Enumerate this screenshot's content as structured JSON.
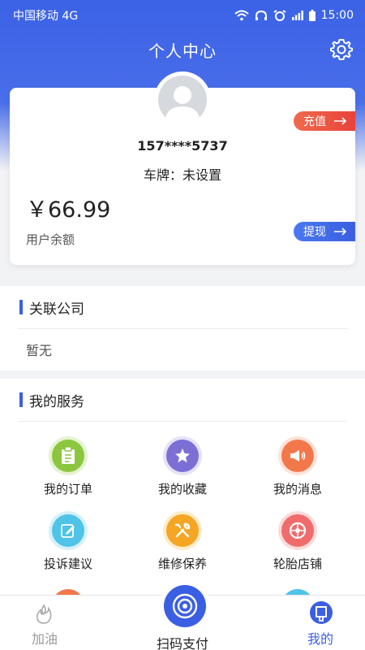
{
  "status_bar": {
    "carrier": "中国移动 4G",
    "time": "15:00"
  },
  "header": {
    "title": "个人中心",
    "settings_icon": "gear-icon"
  },
  "profile": {
    "phone": "157****5737",
    "plate": "车牌：未设置",
    "balance": "￥66.99",
    "balance_label": "用户余额",
    "recharge_label": "充值",
    "withdraw_label": "提现"
  },
  "company": {
    "title": "关联公司",
    "empty_text": "暂无"
  },
  "services": {
    "title": "我的服务",
    "items": [
      {
        "label": "我的订单",
        "icon": "clipboard-icon",
        "color": "#8cc63f"
      },
      {
        "label": "我的收藏",
        "icon": "star-icon",
        "color": "#7b6fd6"
      },
      {
        "label": "我的消息",
        "icon": "megaphone-icon",
        "color": "#f2784b"
      },
      {
        "label": "投诉建议",
        "icon": "edit-icon",
        "color": "#4fc3e8"
      },
      {
        "label": "维修保养",
        "icon": "wrench-icon",
        "color": "#f5a623"
      },
      {
        "label": "轮胎店铺",
        "icon": "tire-icon",
        "color": "#f06c6c"
      }
    ]
  },
  "tabbar": {
    "refuel": "加油",
    "scan_pay": "扫码支付",
    "mine": "我的",
    "accent": "#3b5fe2"
  }
}
